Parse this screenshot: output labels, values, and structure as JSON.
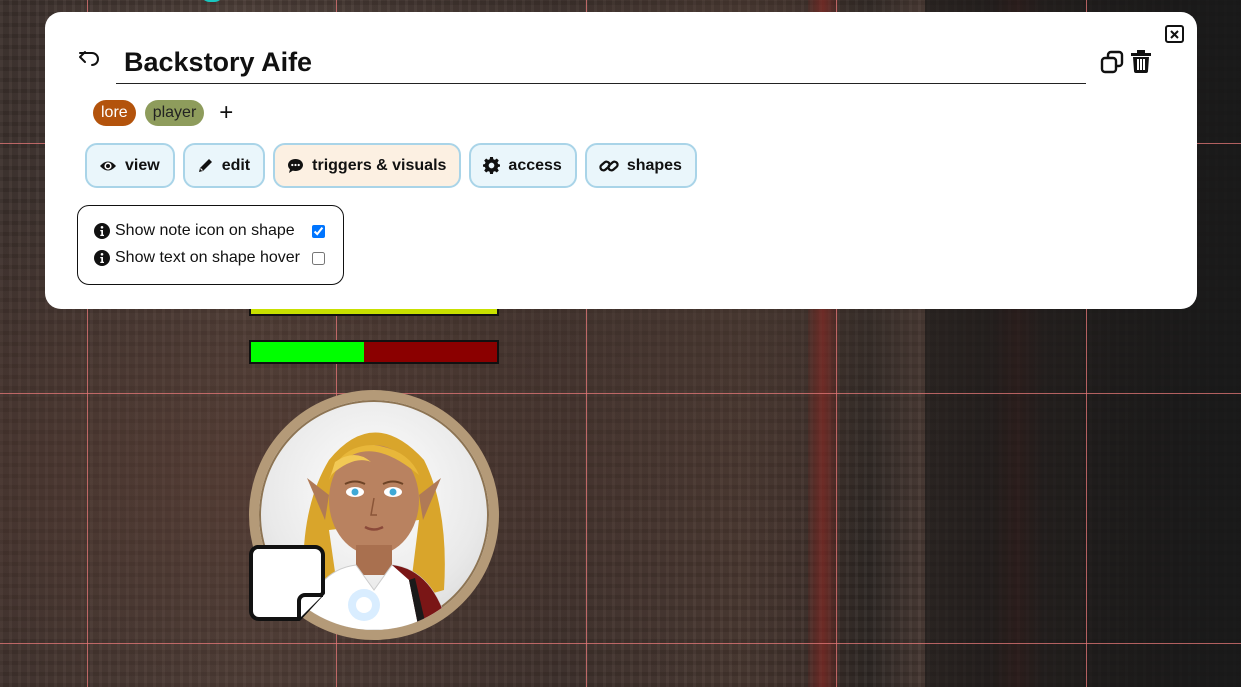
{
  "note": {
    "title": "Backstory Aife",
    "tags": [
      {
        "label": "lore",
        "color": "#b3530c"
      },
      {
        "label": "player",
        "color": "#8e9c5c"
      }
    ],
    "add_tag_label": "+"
  },
  "tabs": [
    {
      "label": "view",
      "icon": "eye-icon",
      "active": false
    },
    {
      "label": "edit",
      "icon": "pencil-icon",
      "active": false
    },
    {
      "label": "triggers & visuals",
      "icon": "speech-bubble-icon",
      "active": true
    },
    {
      "label": "access",
      "icon": "gear-icon",
      "active": false
    },
    {
      "label": "shapes",
      "icon": "link-icon",
      "active": false
    }
  ],
  "options": [
    {
      "label": "Show note icon on shape",
      "checked": true
    },
    {
      "label": "Show text on shape hover",
      "checked": false
    }
  ],
  "token": {
    "health_fraction": 0.46,
    "bar_colors": {
      "yellow": "#c8e000",
      "health": "#00ff00",
      "damage": "#8b0000"
    }
  },
  "colors": {
    "tab_border": "#a9d4e8",
    "tab_bg": "#eaf6fb",
    "tab_active_bg": "#fcf0e2"
  }
}
